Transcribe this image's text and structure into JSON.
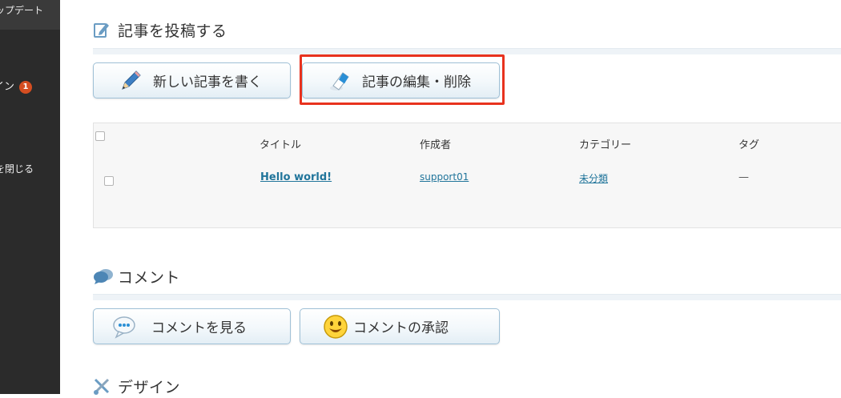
{
  "sidebar": {
    "update_label": "ップデート",
    "design_label": "イン",
    "design_badge": "1",
    "close_menu_label": "を閉じる"
  },
  "posts_section": {
    "title": "記事を投稿する",
    "new_post_button": "新しい記事を書く",
    "edit_posts_button": "記事の編集・削除",
    "highlighted_button": "edit_posts_button"
  },
  "table": {
    "columns": [
      "タイトル",
      "作成者",
      "カテゴリー",
      "タグ"
    ],
    "rows": [
      {
        "title": "Hello world!",
        "author": "support01",
        "category": "未分類",
        "tags": "—"
      }
    ]
  },
  "comments_section": {
    "title": "コメント",
    "view_comments_button": "コメントを見る",
    "approve_comments_button": "コメントの承認"
  },
  "design_section": {
    "title": "デザイン"
  },
  "colors": {
    "link": "#21759b",
    "highlight_border": "#e8321e",
    "badge": "#d54e21",
    "sidebar_bg": "#2b2b2b"
  },
  "icons": {
    "posts_heading": "note-pencil-icon",
    "new_post": "pencil-icon",
    "edit_posts": "eraser-icon",
    "comments_heading": "speech-bubbles-icon",
    "view_comments": "speech-bubble-icon",
    "approve_comments": "smiley-icon",
    "design_heading": "scissors-icon"
  }
}
